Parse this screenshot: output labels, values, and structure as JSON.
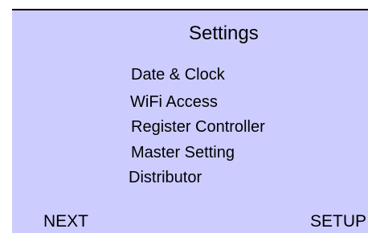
{
  "title": "Settings",
  "menu": {
    "items": [
      {
        "label": "Date &  Clock"
      },
      {
        "label": "WiFi Access"
      },
      {
        "label": "Register Controller"
      },
      {
        "label": "Master Setting"
      },
      {
        "label": "Distributor"
      }
    ]
  },
  "softkeys": {
    "left": "NEXT",
    "right": "SETUP"
  },
  "colors": {
    "background": "#ccccff",
    "text": "#000000",
    "top_border": "#000000"
  }
}
